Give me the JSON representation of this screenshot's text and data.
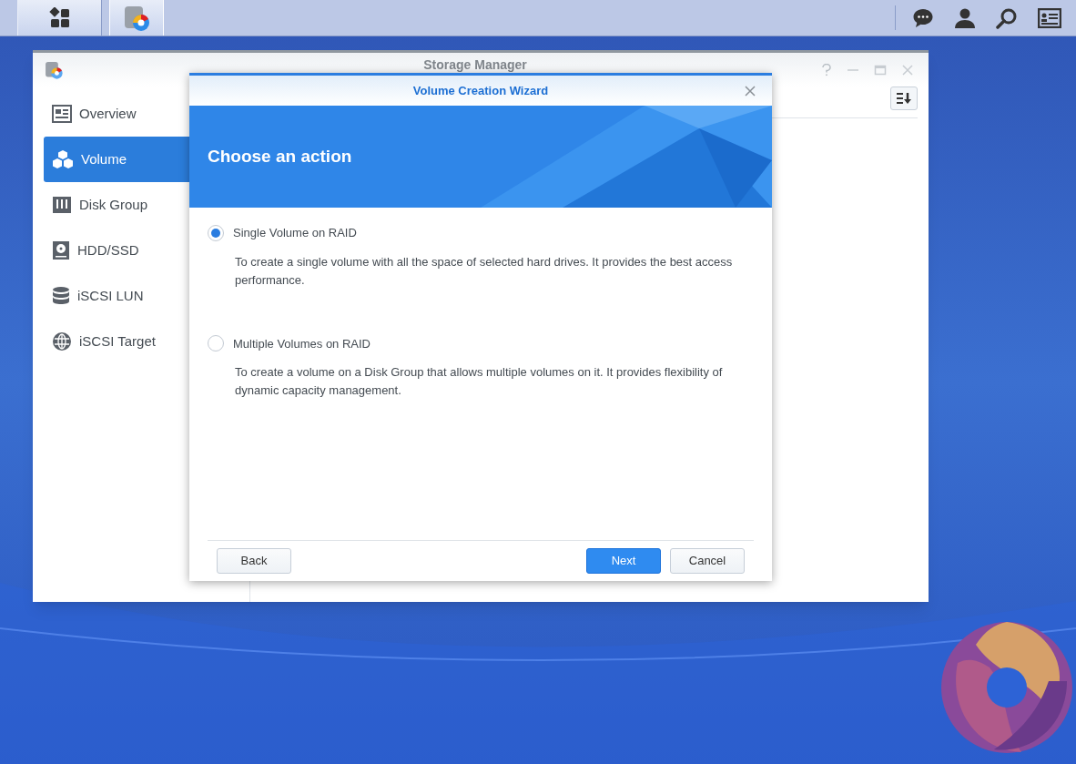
{
  "window": {
    "title": "Storage Manager"
  },
  "sidebar": {
    "items": [
      {
        "label": "Overview",
        "selected": false
      },
      {
        "label": "Volume",
        "selected": true
      },
      {
        "label": "Disk Group",
        "selected": false
      },
      {
        "label": "HDD/SSD",
        "selected": false
      },
      {
        "label": "iSCSI LUN",
        "selected": false
      },
      {
        "label": "iSCSI Target",
        "selected": false
      }
    ]
  },
  "wizard": {
    "title": "Volume Creation Wizard",
    "heading": "Choose an action",
    "options": [
      {
        "label": "Single Volume on RAID",
        "description": "To create a single volume with all the space of selected hard drives. It provides the best access performance.",
        "selected": true
      },
      {
        "label": "Multiple Volumes on RAID",
        "description": "To create a volume on a Disk Group that allows multiple volumes on it. It provides flexibility of dynamic capacity management.",
        "selected": false
      }
    ],
    "buttons": {
      "back": "Back",
      "next": "Next",
      "cancel": "Cancel"
    }
  }
}
